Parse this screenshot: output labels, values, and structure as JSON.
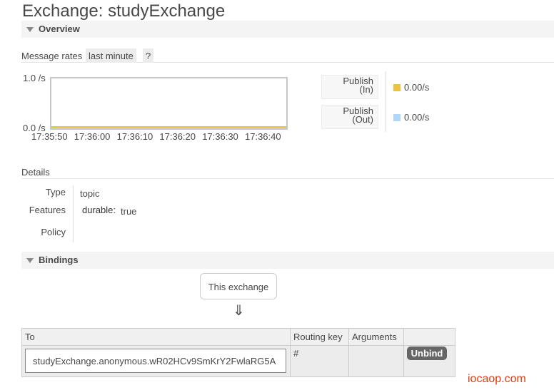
{
  "page": {
    "title": "Exchange: studyExchange"
  },
  "overview": {
    "header": "Overview",
    "rates_label": "Message rates",
    "range": "last minute",
    "help": "?",
    "chart_data": {
      "type": "line",
      "y_labels": [
        "1.0 /s",
        "0.0 /s"
      ],
      "ylim": [
        0,
        1
      ],
      "x_ticks": [
        "17:35:50",
        "17:36:00",
        "17:36:10",
        "17:36:20",
        "17:36:30",
        "17:36:40"
      ],
      "series": [
        {
          "name": "Publish (In)",
          "color": "#edc240",
          "values": [
            0,
            0,
            0,
            0,
            0,
            0
          ]
        },
        {
          "name": "Publish (Out)",
          "color": "#afd8f8",
          "values": [
            0,
            0,
            0,
            0,
            0,
            0
          ]
        }
      ]
    },
    "legend": [
      {
        "line1": "Publish",
        "line2": "(In)",
        "value": "0.00/s",
        "color": "#edc240"
      },
      {
        "line1": "Publish",
        "line2": "(Out)",
        "value": "0.00/s",
        "color": "#afd8f8"
      }
    ]
  },
  "details": {
    "header": "Details",
    "type_key": "Type",
    "type_value": "topic",
    "features_key": "Features",
    "durable_key": "durable:",
    "durable_value": "true",
    "policy_key": "Policy",
    "policy_value": ""
  },
  "bindings": {
    "header": "Bindings",
    "this_exchange": "This exchange",
    "arrow": "⇓",
    "columns": [
      "To",
      "Routing key",
      "Arguments",
      ""
    ],
    "rows": [
      {
        "to": "studyExchange.anonymous.wR02HCv9SmKrY2FwlaRG5A",
        "routing_key": "#",
        "arguments": "",
        "action": "Unbind"
      }
    ]
  },
  "watermark": "iocaop.com"
}
